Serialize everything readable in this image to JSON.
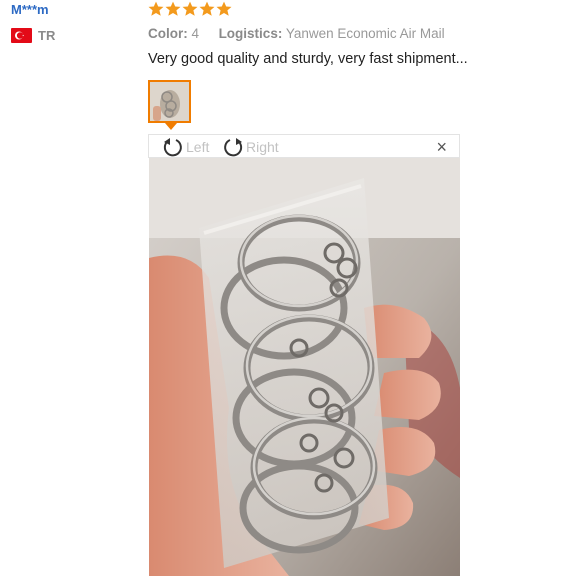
{
  "review": {
    "user_name": "M***m",
    "country_code": "TR",
    "rating": 5,
    "color_label": "Color:",
    "color_value": "4",
    "logistics_label": "Logistics:",
    "logistics_value": "Yanwen Economic Air Mail",
    "text": "Very good quality and sturdy, very fast shipment..."
  },
  "viewer": {
    "rotate_left_label": "Left",
    "rotate_right_label": "Right",
    "close_glyph": "×"
  },
  "colors": {
    "accent": "#f07c00",
    "user_name": "#2d6ac4",
    "star": "#f39a1d",
    "flag": "#e30a17"
  },
  "icons": [
    "star-icon",
    "turkey-flag-icon",
    "rotate-left-icon",
    "rotate-right-icon",
    "close-icon"
  ]
}
